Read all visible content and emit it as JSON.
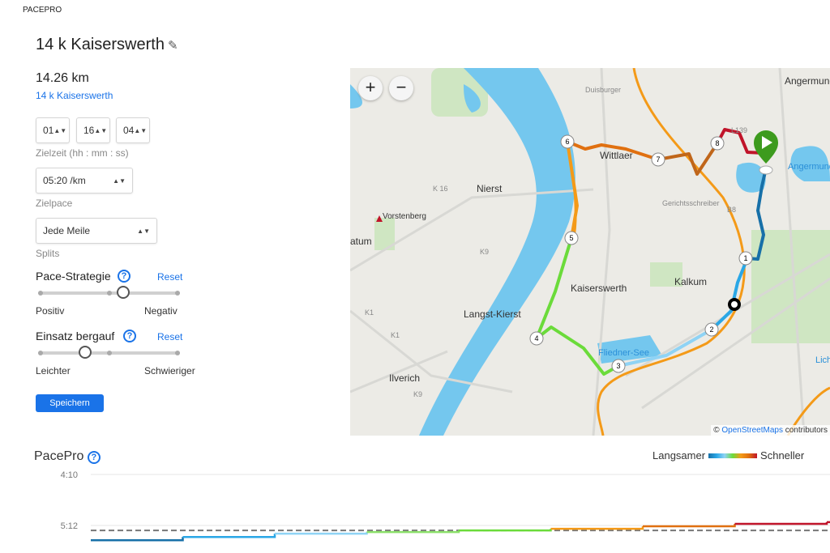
{
  "app": {
    "brand": "PACEPRO"
  },
  "course": {
    "title": "14 k Kaiserswerth",
    "distance": "14.26 km",
    "link": "14 k Kaiserswerth"
  },
  "form": {
    "time": {
      "hh": "01",
      "mm": "16",
      "ss": "04",
      "label": "Zielzeit (hh : mm : ss)"
    },
    "pace": {
      "value": "05:20 /km",
      "label": "Zielpace"
    },
    "splits": {
      "value": "Jede Meile",
      "label": "Splits"
    },
    "strategy": {
      "title": "Pace-Strategie",
      "reset": "Reset",
      "left": "Positiv",
      "right": "Negativ",
      "level": 0.6
    },
    "uphill": {
      "title": "Einsatz bergauf",
      "reset": "Reset",
      "left": "Leichter",
      "right": "Schwieriger",
      "level": 0.33
    },
    "save": "Speichern"
  },
  "map": {
    "zoom_in": "+",
    "zoom_out": "−",
    "places": [
      "Angermund",
      "Angermunder See",
      "Wittlaer",
      "Nierst",
      "Vorstenberg",
      "atum",
      "Kaiserswerth",
      "Kalkum",
      "Langst-Kierst",
      "Fliedner-See",
      "Ilverich",
      "Lich"
    ],
    "roads": [
      "K 16",
      "K9",
      "K1",
      "K1",
      "K9",
      "L139",
      "B8",
      "Duisburger",
      "Gerichtsschreiber"
    ],
    "markers": [
      "1",
      "2",
      "3",
      "4",
      "5",
      "6",
      "7",
      "8"
    ],
    "attribution": {
      "prefix": "©",
      "link": "OpenStreetMaps",
      "suffix": "contributors"
    },
    "colors": {
      "water": "#74c7ee",
      "route_slow": "#1770a8",
      "route_fast": "#c0142a",
      "road": "#f49a18"
    }
  },
  "chart": {
    "title": "PacePro",
    "legend_slow": "Langsamer",
    "legend_fast": "Schneller"
  },
  "chart_data": {
    "type": "line",
    "yticks": [
      "4:10",
      "5:12"
    ],
    "y_unit": "min/km",
    "target_pace": "5:20",
    "segments": [
      {
        "pace": "5:30",
        "color": "#1770a8"
      },
      {
        "pace": "5:26",
        "color": "#2aa7e6"
      },
      {
        "pace": "5:22",
        "color": "#8fd3f5"
      },
      {
        "pace": "5:20",
        "color": "#8be06a"
      },
      {
        "pace": "5:18",
        "color": "#6bdb3a"
      },
      {
        "pace": "5:16",
        "color": "#f49a18"
      },
      {
        "pace": "5:13",
        "color": "#e07010"
      },
      {
        "pace": "5:10",
        "color": "#c0142a"
      },
      {
        "pace": "5:08",
        "color": "#c0142a"
      }
    ]
  }
}
